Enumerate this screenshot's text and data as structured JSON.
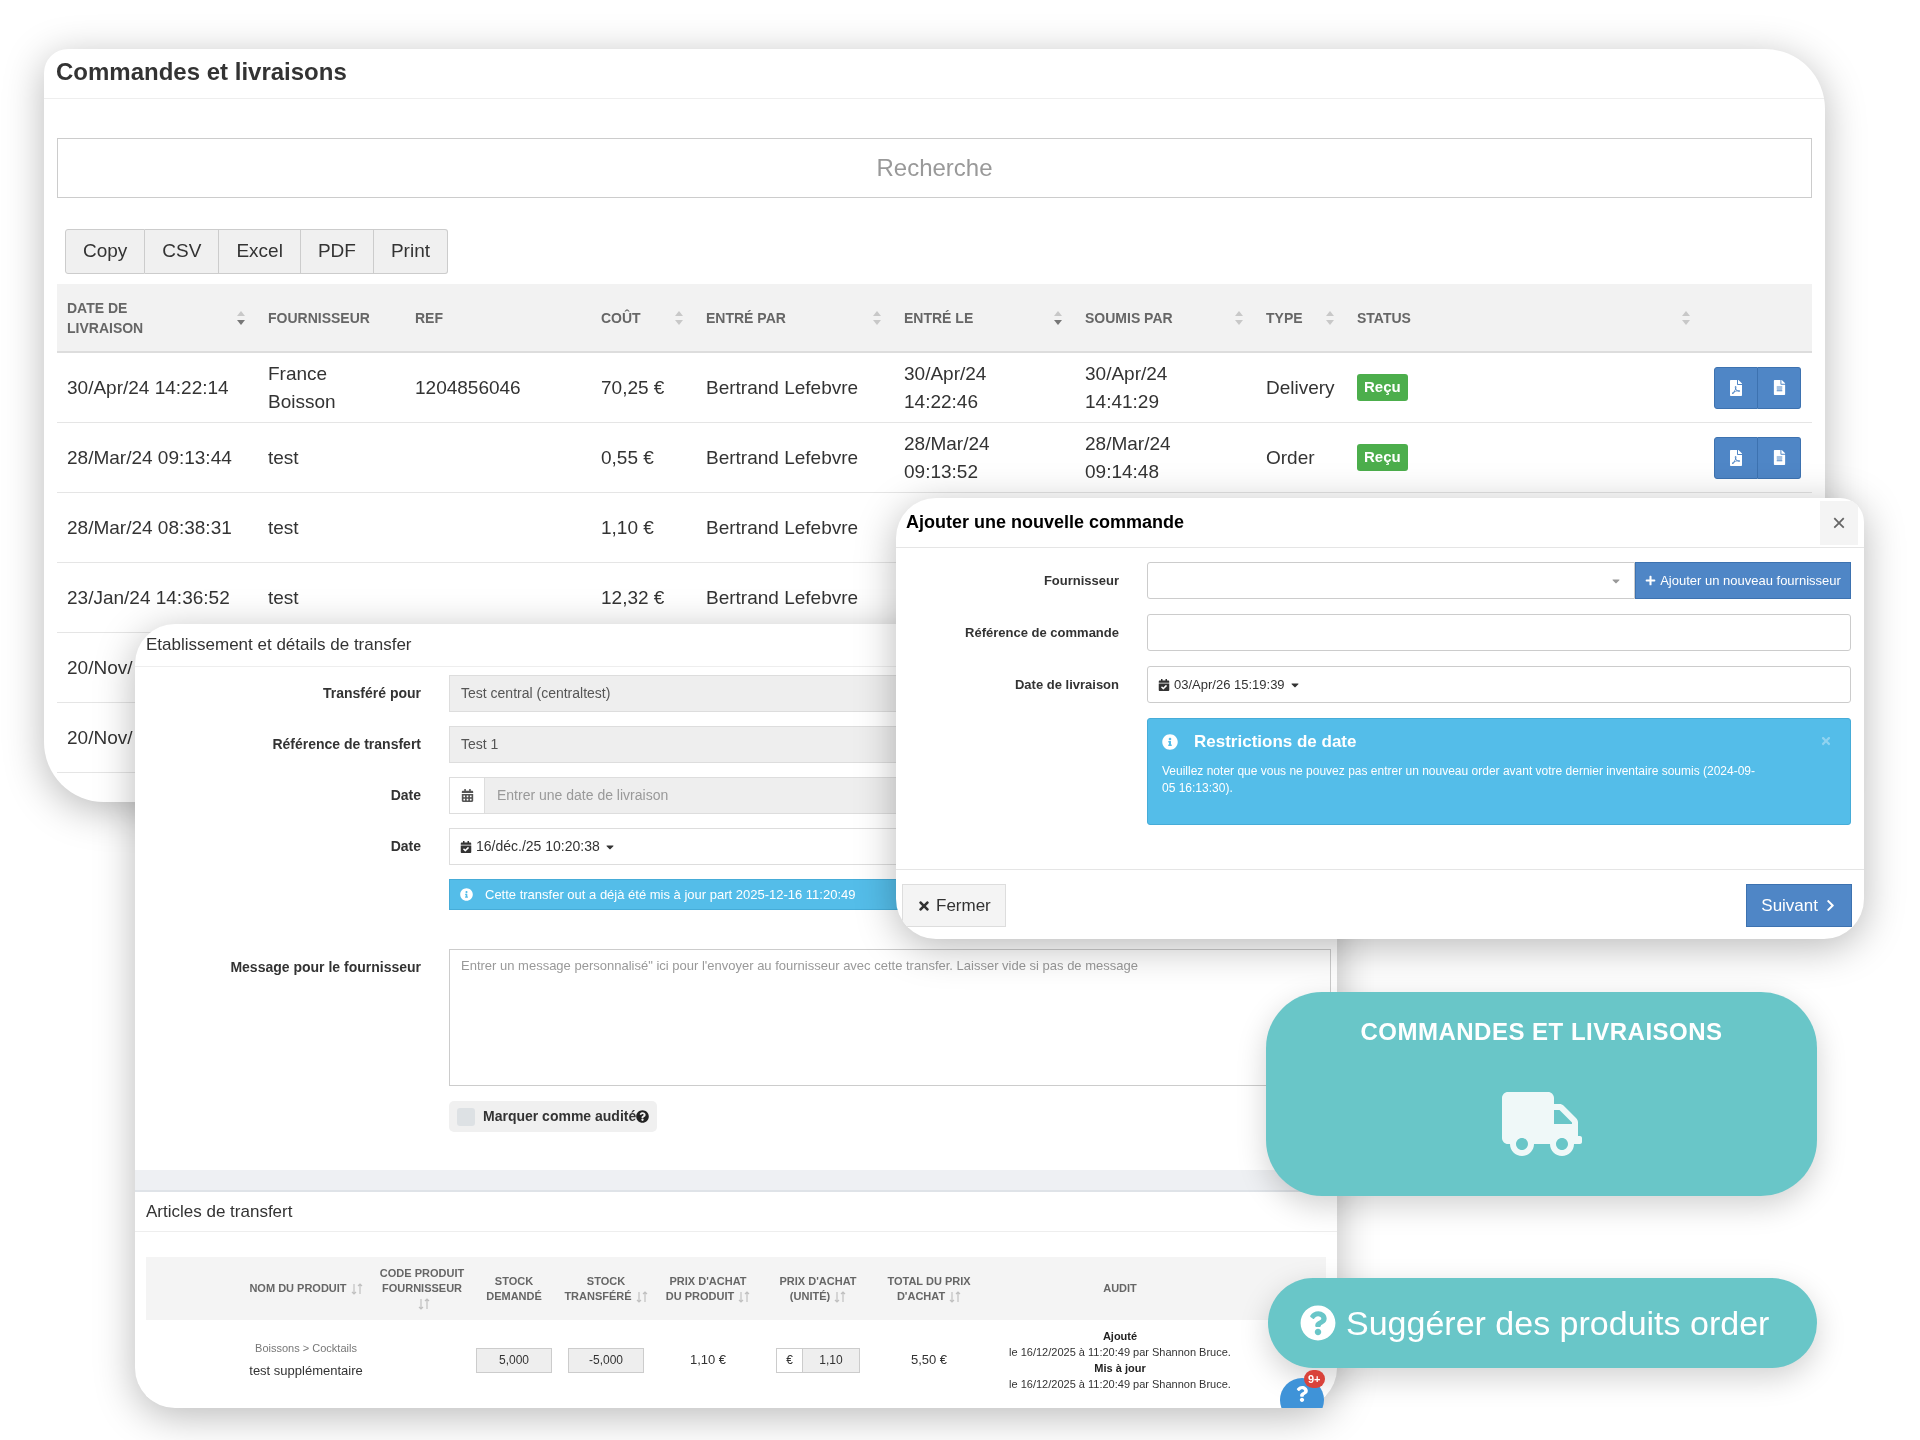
{
  "orders_panel": {
    "title": "Commandes et livraisons",
    "search": {
      "placeholder": "Recherche"
    },
    "export_buttons": [
      "Copy",
      "CSV",
      "Excel",
      "PDF",
      "Print"
    ],
    "table": {
      "columns": [
        {
          "label": "DATE DE LIVRAISON",
          "sorted": true,
          "kind": "text"
        },
        {
          "label": "FOURNISSEUR",
          "kind": "text"
        },
        {
          "label": "REF",
          "kind": "text"
        },
        {
          "label": "COÛT",
          "sorted": false,
          "kind": "text"
        },
        {
          "label": "ENTRÉ PAR",
          "sorted": false,
          "kind": "text"
        },
        {
          "label": "ENTRÉ LE",
          "sorted": true,
          "kind": "text"
        },
        {
          "label": "SOUMIS PAR",
          "sorted": false,
          "kind": "text"
        },
        {
          "label": "TYPE",
          "sorted": false,
          "kind": "text"
        },
        {
          "label": "STATUS",
          "sorted": false,
          "kind": "badge"
        }
      ],
      "rows": [
        {
          "cells": [
            "30/Apr/24 14:22:14",
            "France Boisson",
            "1204856046",
            "70,25 €",
            "Bertrand Lefebvre",
            "30/Apr/24 14:22:46",
            "30/Apr/24 14:41:29",
            "Delivery",
            "Reçu"
          ],
          "actions": true
        },
        {
          "cells": [
            "28/Mar/24 09:13:44",
            "test",
            null,
            "0,55 €",
            "Bertrand Lefebvre",
            "28/Mar/24 09:13:52",
            "28/Mar/24 09:14:48",
            "Order",
            "Reçu"
          ],
          "actions": true
        },
        {
          "cells": [
            "28/Mar/24 08:38:31",
            "test",
            null,
            "1,10 €",
            "Bertrand Lefebvre",
            null,
            null,
            null,
            null
          ]
        },
        {
          "cells": [
            "23/Jan/24 14:36:52",
            "test",
            null,
            "12,32 €",
            "Bertrand Lefebvre",
            null,
            null,
            null,
            null
          ]
        },
        {
          "cells": [
            "20/Nov/",
            null,
            null,
            null,
            null,
            null,
            null,
            null,
            null
          ]
        },
        {
          "cells": [
            "20/Nov/",
            null,
            null,
            null,
            null,
            null,
            null,
            null,
            null
          ]
        }
      ]
    }
  },
  "transfer_panel": {
    "title": "Etablissement et détails de transfer",
    "fields": [
      {
        "kind": "readonly",
        "label": "Transféré pour",
        "value": "Test central (centraltest)"
      },
      {
        "kind": "readonly",
        "label": "Référence de transfert",
        "value": "Test 1"
      },
      {
        "kind": "date_input",
        "label": "Date",
        "placeholder": "Entrer une date de livraison"
      },
      {
        "kind": "date_picker",
        "label": "Date",
        "value": "16/déc./25 10:20:38"
      },
      {
        "kind": "info",
        "text": "Cette transfer out a déjà été mis à jour part 2025-12-16 11:20:49"
      },
      {
        "kind": "textarea",
        "label": "Message pour le fournisseur",
        "placeholder": "Entrer un message personnalisé\" ici pour l'envoyer au fournisseur avec cette transfer. Laisser vide si pas de message"
      },
      {
        "kind": "checkbox",
        "label": "Marquer comme audité",
        "checked": false
      }
    ],
    "items": {
      "title": "Articles de transfert",
      "columns": [
        {
          "label": "NOM DU PRODUIT",
          "sort": true
        },
        {
          "label": "CODE PRODUIT FOURNISSEUR",
          "sort": true
        },
        {
          "label": "STOCK DEMANDÉ",
          "sort": false
        },
        {
          "label": "STOCK TRANSFÉRÉ",
          "sort": true
        },
        {
          "label": "PRIX D'ACHAT DU PRODUIT",
          "sort": true
        },
        {
          "label": "PRIX D'ACHAT (UNITÉ)",
          "sort": true
        },
        {
          "label": "TOTAL DU PRIX D'ACHAT",
          "sort": true
        },
        {
          "label": "AUDIT",
          "sort": false
        }
      ],
      "rows": [
        {
          "category": "Boissons > Cocktails",
          "product": "test supplémentaire",
          "stock_requested": "5,000",
          "stock_transferred": "-5,000",
          "product_price": "1,10 €",
          "currency": "€",
          "unit_price": "1,10",
          "total": "5,50 €",
          "audit": [
            {
              "label": "Ajouté",
              "text": "le 16/12/2025 à 11:20:49 par Shannon Bruce."
            },
            {
              "label": "Mis à jour",
              "text": "le 16/12/2025 à 11:20:49 par Shannon Bruce."
            }
          ]
        }
      ]
    }
  },
  "order_modal": {
    "title": "Ajouter une nouvelle commande",
    "close": "×",
    "fields": [
      {
        "kind": "select",
        "label": "Fournisseur",
        "button": "Ajouter un nouveau fournisseur"
      },
      {
        "kind": "text",
        "label": "Référence de commande"
      },
      {
        "kind": "date_picker",
        "label": "Date de livraison",
        "value": "03/Apr/26 15:19:39"
      }
    ],
    "alert": {
      "title": "Restrictions de date",
      "text": "Veuillez noter que vous ne pouvez pas entrer un nouveau order avant votre dernier inventaire soumis (2024-09-05 16:13:30)."
    },
    "buttons": [
      {
        "kind": "close",
        "label": "Fermer"
      },
      {
        "kind": "next",
        "label": "Suivant"
      }
    ]
  },
  "feature_card": {
    "title": "COMMANDES ET LIVRAISONS"
  },
  "suggest_button": {
    "label": "Suggérer des produits order"
  },
  "help_bubble": {
    "badge": "9+"
  }
}
